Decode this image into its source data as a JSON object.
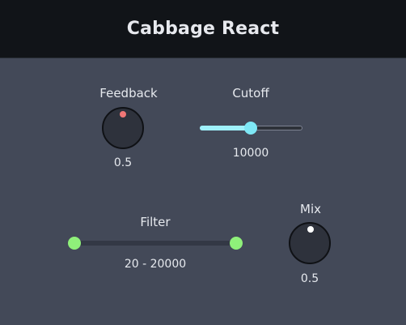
{
  "app": {
    "title": "Cabbage React"
  },
  "feedback": {
    "label": "Feedback",
    "value_text": "0.5",
    "value": 0.5,
    "dot_color": "#f07676"
  },
  "cutoff": {
    "label": "Cutoff",
    "value_text": "10000",
    "value": 10000,
    "min": 20,
    "max": 20000,
    "fill_color": "#9ff0fb",
    "thumb_color": "#7ee7f5"
  },
  "filter": {
    "label": "Filter",
    "range_text": "20 - 20000",
    "low": 20,
    "high": 20000,
    "thumb_color": "#8ff07a"
  },
  "mix": {
    "label": "Mix",
    "value_text": "0.5",
    "value": 0.5,
    "dot_color": "#ffffff"
  }
}
